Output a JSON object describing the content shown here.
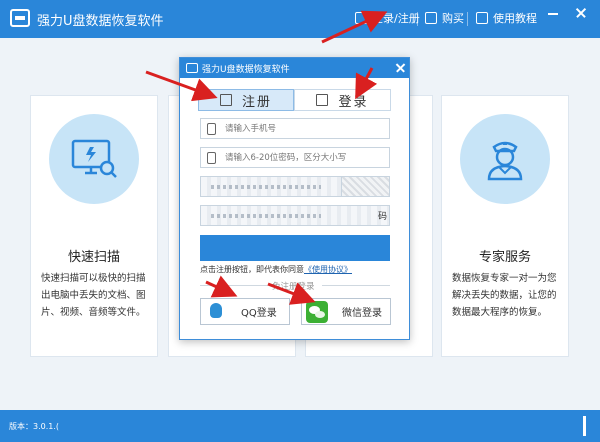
{
  "app": {
    "title": "强力U盘数据恢复软件"
  },
  "toolbar": {
    "login_label": "登录/注册",
    "buy_label": "购买",
    "tutorial_label": "使用教程"
  },
  "cards": [
    {
      "title": "快速扫描",
      "desc": "快速扫描可以极快的扫描出电脑中丢失的文档、图片、视频、音频等文件。"
    },
    {
      "title": "专家服务",
      "desc": "数据恢复专家一对一为您解决丢失的数据，让您的数据最大程序的恢复。"
    }
  ],
  "status": {
    "version": "版本：3.0.1.("
  },
  "dialog": {
    "title": "强力U盘数据恢复软件",
    "tab_register": "注册",
    "tab_login": "登录",
    "phone_placeholder": "请输入手机号",
    "password_placeholder": "请输入6-20位密码，区分大小写",
    "captcha_refresh": "码",
    "agree_text": "点击注册按钮，即代表你同意",
    "agree_link": "《使用协议》",
    "divider_text": "免注册登录",
    "qq_label": "QQ登录",
    "wechat_label": "微信登录"
  },
  "colors": {
    "primary": "#2a86d9",
    "background": "#eef3f8",
    "annotation": "#d92020"
  }
}
